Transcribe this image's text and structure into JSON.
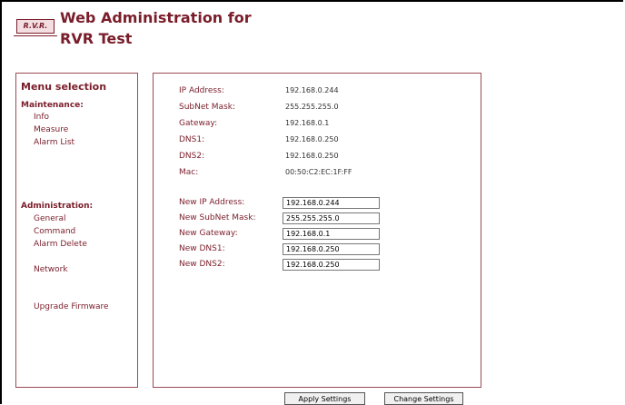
{
  "header": {
    "logo_text": "R.V.R.",
    "title_line1": "Web Administration for",
    "title_line2": "RVR Test"
  },
  "menu": {
    "title": "Menu selection",
    "maintenance": {
      "heading": "Maintenance:",
      "items": [
        "Info",
        "Measure",
        "Alarm List"
      ]
    },
    "administration": {
      "heading": "Administration:",
      "items": [
        "General",
        "Command",
        "Alarm Delete"
      ]
    },
    "network": "Network",
    "upgrade": "Upgrade Firmware"
  },
  "current": [
    {
      "label": "IP Address:",
      "value": "192.168.0.244"
    },
    {
      "label": "SubNet Mask:",
      "value": "255.255.255.0"
    },
    {
      "label": "Gateway:",
      "value": "192.168.0.1"
    },
    {
      "label": "DNS1:",
      "value": "192.168.0.250"
    },
    {
      "label": "DNS2:",
      "value": "192.168.0.250"
    },
    {
      "label": "Mac:",
      "value": "00:50:C2:EC:1F:FF"
    }
  ],
  "new_settings": [
    {
      "label": "New IP Address:",
      "value": "192.168.0.244"
    },
    {
      "label": "New SubNet Mask:",
      "value": "255.255.255.0"
    },
    {
      "label": "New Gateway:",
      "value": "192.168.0.1"
    },
    {
      "label": "New DNS1:",
      "value": "192.168.0.250"
    },
    {
      "label": "New DNS2:",
      "value": "192.168.0.250"
    }
  ],
  "buttons": {
    "apply": "Apply Settings",
    "change": "Change Settings"
  },
  "colors": {
    "accent": "#7a1d2a",
    "panel_border": "#9a4a55"
  }
}
